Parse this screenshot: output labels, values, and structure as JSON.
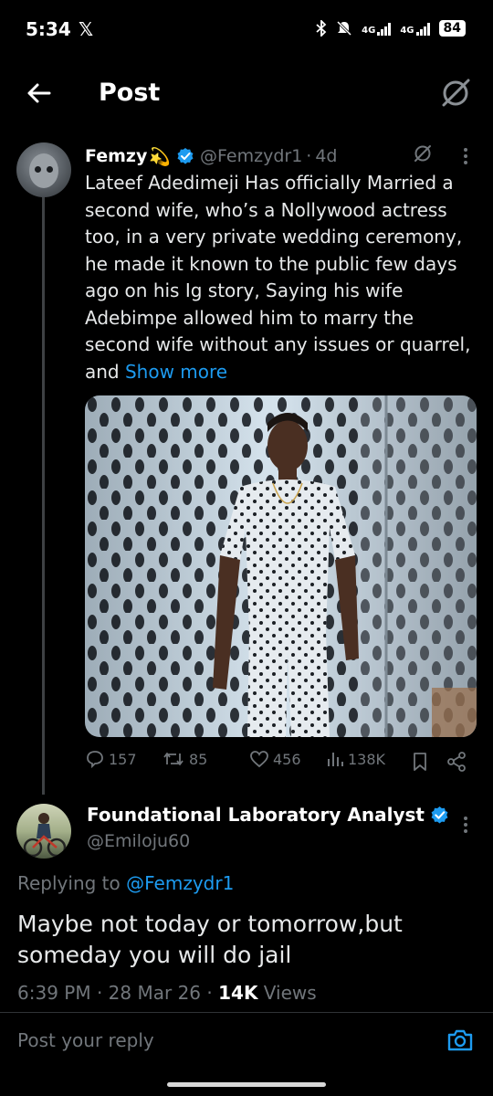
{
  "status_bar": {
    "time": "5:34",
    "x_label": "𝕏",
    "network1": "4G",
    "network2": "4G",
    "battery": "84"
  },
  "header": {
    "title": "Post"
  },
  "post": {
    "author_name": "Femzy",
    "author_emoji": "💫",
    "handle": "@Femzydr1",
    "separator": "·",
    "age": "4d",
    "text": "Lateef Adedimeji Has officially Married a second wife, who’s a Nollywood actress too, in a very private wedding ceremony, he made it known to the public few days ago on his Ig story, Saying his wife Adebimpe allowed him to marry the second wife without any issues or quarrel, and ",
    "show_more": "Show more",
    "stats": {
      "replies": "157",
      "reposts": "85",
      "likes": "456",
      "views": "138K"
    }
  },
  "reply": {
    "author_name": "Foundational Laboratory Analyst",
    "handle": "@Emiloju60",
    "replying_prefix": "Replying to ",
    "replying_handle": "@Femzydr1",
    "text": "Maybe not today or tomorrow,but someday you will do jail",
    "time": "6:39 PM",
    "sep1": " · ",
    "date": "28 Mar 26",
    "sep2": " · ",
    "views_count": "14K",
    "views_label": " Views"
  },
  "reply_bar": {
    "placeholder": "Post your reply"
  },
  "colors": {
    "accent": "#1d9bf0",
    "muted": "#71767b",
    "background": "#000000"
  }
}
